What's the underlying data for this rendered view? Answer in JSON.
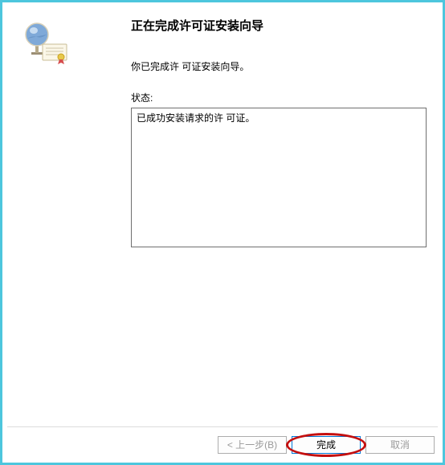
{
  "wizard": {
    "title": "正在完成许可证安装向导",
    "message": "你已完成许 可证安装向导。",
    "status_label": "状态:",
    "status_text": "已成功安装请求的许 可证。"
  },
  "buttons": {
    "back": "< 上一步(B)",
    "finish": "完成",
    "cancel": "取消"
  }
}
